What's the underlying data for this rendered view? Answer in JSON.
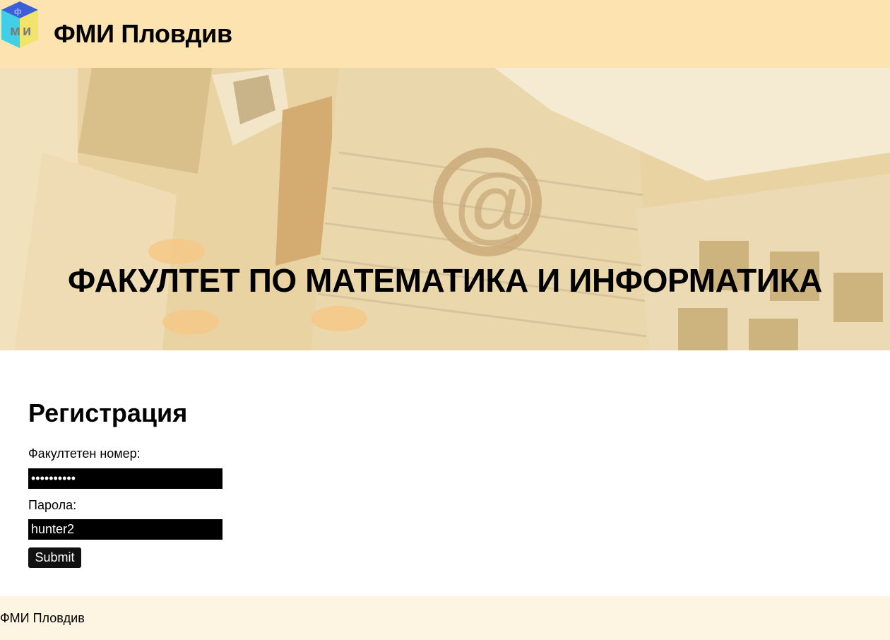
{
  "header": {
    "site_title": "ФМИ Пловдив",
    "logo_icon": "fmi-logo-cube-icon"
  },
  "hero": {
    "title": "ФАКУЛТЕТ ПО МАТЕМАТИКА И ИНФОРМАТИКА",
    "background": "faded-building-photo"
  },
  "registration": {
    "title": "Регистрация",
    "faculty_number_label": "Факултетен номер:",
    "faculty_number_value": "1234567890",
    "password_label": "Парола:",
    "password_value": "hunter2",
    "submit_label": "Submit"
  },
  "footer": {
    "text": "ФМИ Пловдив"
  },
  "colors": {
    "header_bg": "#fde3b0",
    "hero_bg": "#e6cf9d",
    "footer_bg": "#fdf5e1",
    "field_bg": "#000000"
  }
}
